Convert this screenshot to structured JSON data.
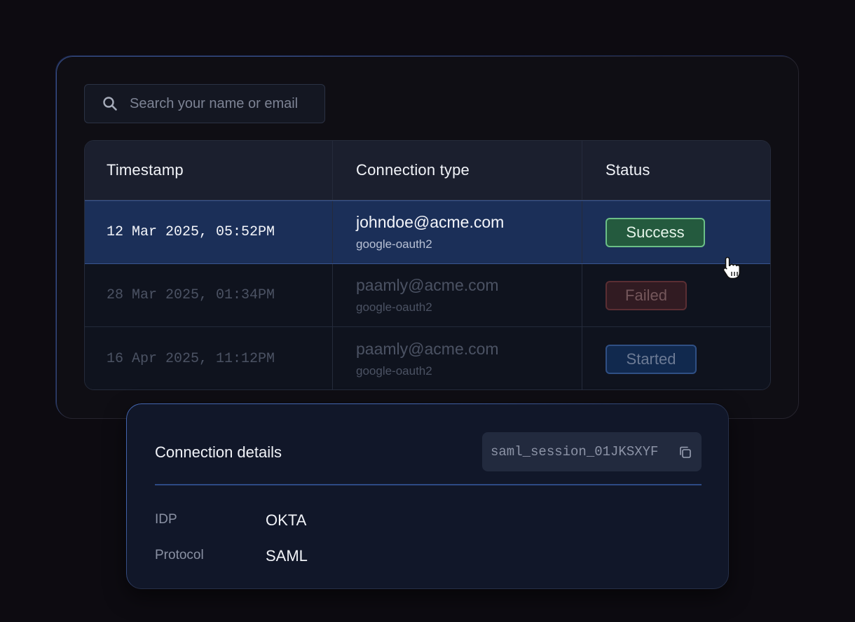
{
  "search": {
    "placeholder": "Search your name or email"
  },
  "table": {
    "columns": [
      "Timestamp",
      "Connection type",
      "Status"
    ],
    "rows": [
      {
        "timestamp": "12 Mar 2025, 05:52PM",
        "email": "johndoe@acme.com",
        "provider": "google-oauth2",
        "status": "Success"
      },
      {
        "timestamp": "28 Mar 2025, 01:34PM",
        "email": "paamly@acme.com",
        "provider": "google-oauth2",
        "status": "Failed"
      },
      {
        "timestamp": "16 Apr 2025, 11:12PM",
        "email": "paamly@acme.com",
        "provider": "google-oauth2",
        "status": "Started"
      }
    ]
  },
  "details": {
    "title": "Connection details",
    "session_id": "saml_session_01JKSXYF",
    "fields": [
      {
        "label": "IDP",
        "value": "OKTA"
      },
      {
        "label": "Protocol",
        "value": "SAML"
      }
    ]
  },
  "colors": {
    "background": "#0d0b11",
    "selected_row": "#1b2f58",
    "success": "#245a3e",
    "failed": "#311b22",
    "started": "#11294e",
    "accent": "#2d4a85"
  },
  "icons": [
    "search-icon",
    "copy-icon",
    "pointer-hand-icon"
  ]
}
